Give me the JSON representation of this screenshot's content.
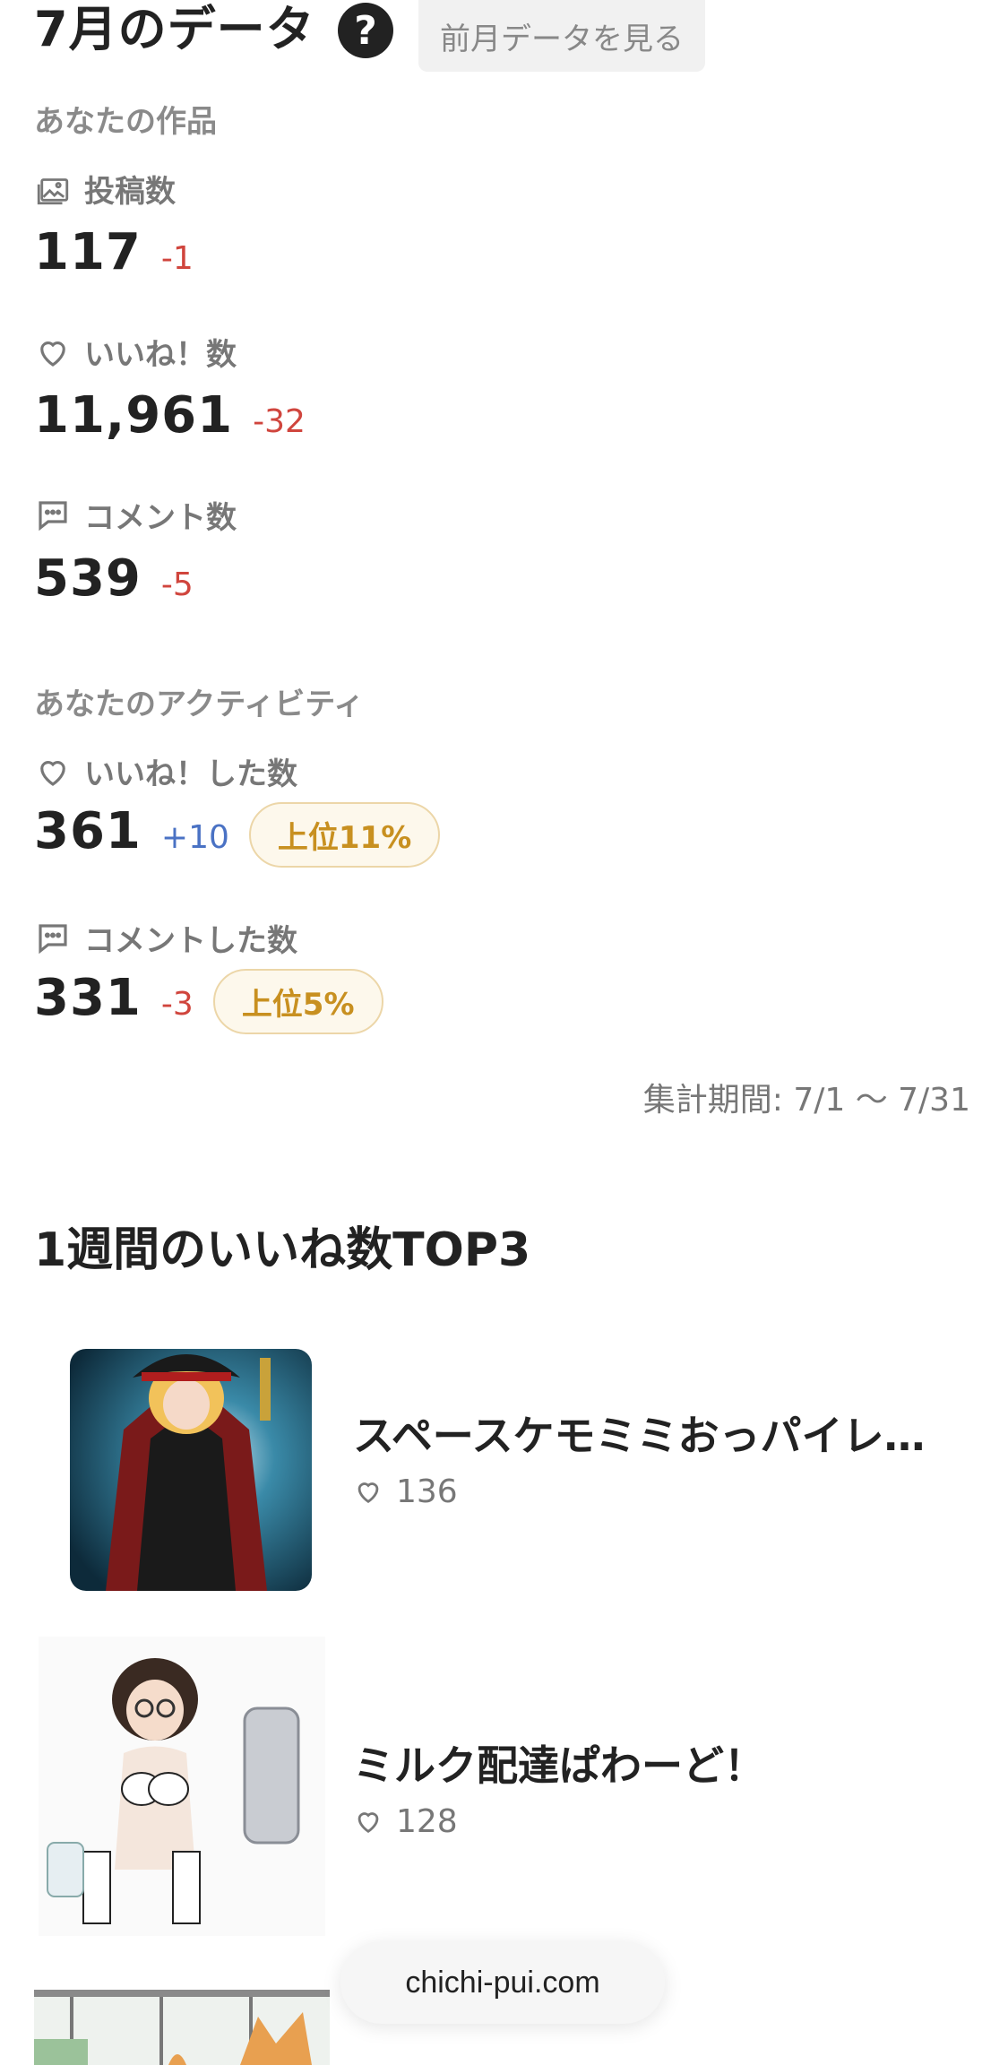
{
  "header": {
    "title": "7月のデータ",
    "help_glyph": "?",
    "prev_button": "前月データを見る"
  },
  "works_section": {
    "title": "あなたの作品",
    "stats": [
      {
        "icon": "gallery-icon",
        "label": "投稿数",
        "value": "117",
        "delta": "-1"
      },
      {
        "icon": "heart-icon",
        "label": "いいね！数",
        "value": "11,961",
        "delta": "-32"
      },
      {
        "icon": "comment-icon",
        "label": "コメント数",
        "value": "539",
        "delta": "-5"
      }
    ]
  },
  "activity_section": {
    "title": "あなたのアクティビティ",
    "stats": [
      {
        "icon": "heart-icon",
        "label": "いいね！した数",
        "value": "361",
        "delta": "+10",
        "rank": "上位11%"
      },
      {
        "icon": "comment-icon",
        "label": "コメントした数",
        "value": "331",
        "delta": "-3",
        "rank": "上位5%"
      }
    ]
  },
  "period": "集計期間: 7/1 〜 7/31",
  "top3": {
    "title": "1週間のいいね数TOP3",
    "items": [
      {
        "title": "スペースケモミミおっパイレ…",
        "likes": "136"
      },
      {
        "title": "ミルク配達ぱわーど！",
        "likes": "128"
      }
    ]
  },
  "domain_pill": "chichi-pui.com",
  "colors": {
    "negative": "#d0453d",
    "positive": "#4a72c4",
    "rank_text": "#c89020",
    "rank_border": "#ecd6a8"
  }
}
